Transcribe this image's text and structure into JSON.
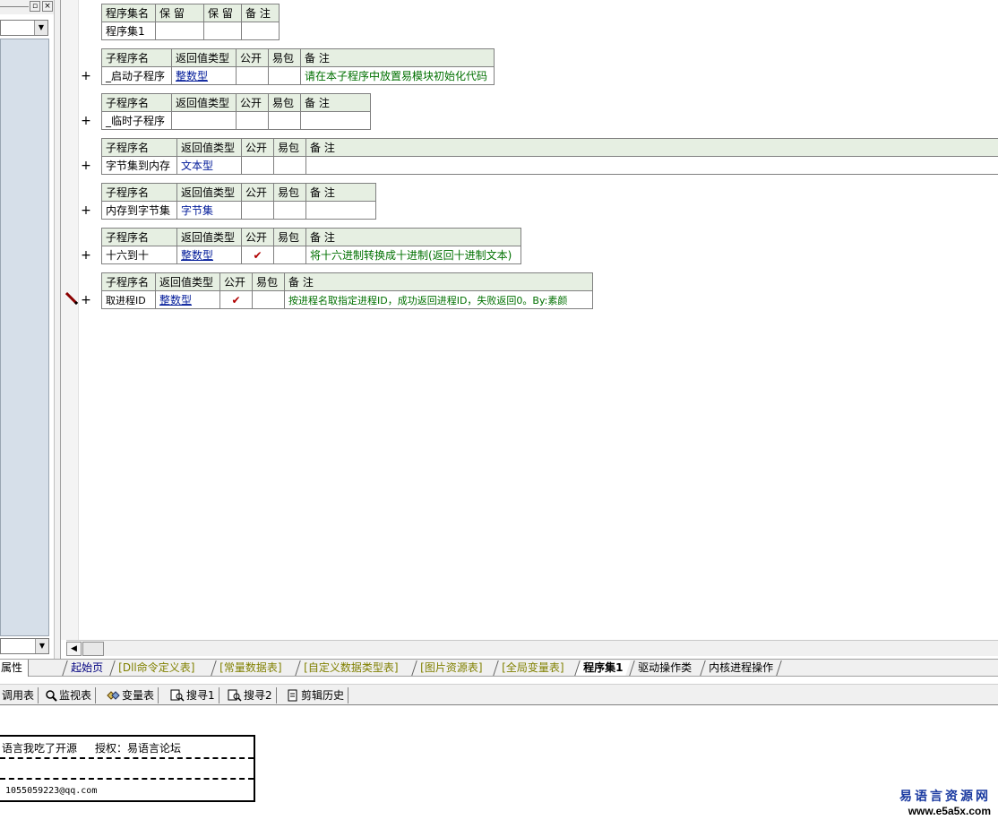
{
  "left_panel": {
    "bottom_tab_label": "属性"
  },
  "assembly_table": {
    "headers": [
      "程序集名",
      "保 留",
      "保 留",
      "备 注"
    ],
    "row": [
      "程序集1",
      "",
      "",
      ""
    ]
  },
  "subroutine_headers": [
    "子程序名",
    "返回值类型",
    "公开",
    "易包",
    "备 注"
  ],
  "subroutines": [
    {
      "name": "_启动子程序",
      "return_type": "整数型",
      "public": "",
      "package": "",
      "note": "请在本子程序中放置易模块初始化代码"
    },
    {
      "name": "_临时子程序",
      "return_type": "",
      "public": "",
      "package": "",
      "note": ""
    },
    {
      "name": "字节集到内存",
      "return_type": "文本型",
      "public": "",
      "package": "",
      "note": ""
    },
    {
      "name": "内存到字节集",
      "return_type": "字节集",
      "public": "",
      "package": "",
      "note": ""
    },
    {
      "name": "十六到十",
      "return_type": "整数型",
      "public": "✔",
      "package": "",
      "note": "将十六进制转换成十进制(返回十进制文本)"
    },
    {
      "name": "取进程ID",
      "return_type": "整数型",
      "public": "✔",
      "package": "",
      "note": "按进程名取指定进程ID，成功返回进程ID，失败返回0。By:素颜"
    }
  ],
  "expand_symbol": "+",
  "tabs": [
    {
      "label": "起始页",
      "style": "blue"
    },
    {
      "label": "[Dll命令定义表]",
      "style": "olive"
    },
    {
      "label": "[常量数据表]",
      "style": "olive"
    },
    {
      "label": "[自定义数据类型表]",
      "style": "olive"
    },
    {
      "label": "[图片资源表]",
      "style": "olive"
    },
    {
      "label": "[全局变量表]",
      "style": "olive"
    },
    {
      "label": "程序集1",
      "style": "active"
    },
    {
      "label": "驱动操作类",
      "style": "plain"
    },
    {
      "label": "内核进程操作",
      "style": "plain"
    }
  ],
  "bottom_tools": [
    {
      "label": "调用表",
      "icon": "call-table-icon"
    },
    {
      "label": "监视表",
      "icon": "magnifier-icon"
    },
    {
      "label": "变量表",
      "icon": "variable-icon"
    },
    {
      "label": "搜寻1",
      "icon": "search1-icon"
    },
    {
      "label": "搜寻2",
      "icon": "search2-icon"
    },
    {
      "label": "剪辑历史",
      "icon": "clip-history-icon"
    }
  ],
  "output": {
    "line1_left": "语言我吃了开源",
    "line1_right": "授权：易语言论坛",
    "email": "1055059223@qq.com"
  },
  "watermark": {
    "title": "易语言资源网",
    "url": "www.e5a5x.com"
  },
  "colors": {
    "header_bg": "#e6efe2",
    "type_blue": "#001a99",
    "note_green": "#007000",
    "check_red": "#b00000",
    "tree_bg": "#d6dfe9"
  }
}
